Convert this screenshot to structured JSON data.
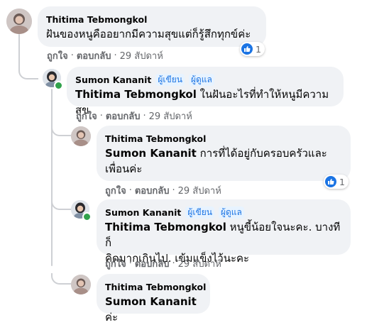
{
  "comments": [
    {
      "author": "Thitima Tebmongkol",
      "text": "ฝันของหนูคืออยากมีความสุขแต่ก็รู้สึกทุกข์ค่ะ",
      "like_label": "ถูกใจ",
      "reply_label": "ตอบกลับ",
      "time": "29 สัปดาห์",
      "reaction_count": "1"
    },
    {
      "author": "Sumon Kananit",
      "badges": [
        "ผู้เขียน",
        "ผู้ดูแล"
      ],
      "mention": "Thitima Tebmongkol",
      "text": " ในฝันอะไรที่ทำให้หนูมีความสุข",
      "like_label": "ถูกใจ",
      "reply_label": "ตอบกลับ",
      "time": "29 สัปดาห์"
    },
    {
      "author": "Thitima Tebmongkol",
      "mention": "Sumon Kananit",
      "text_line1": " การที่ได้อยู่กับครอบครัวและ",
      "text_line2": "เพื่อนค่ะ",
      "like_label": "ถูกใจ",
      "reply_label": "ตอบกลับ",
      "time": "29 สัปดาห์",
      "reaction_count": "1"
    },
    {
      "author": "Sumon Kananit",
      "badges": [
        "ผู้เขียน",
        "ผู้ดูแล"
      ],
      "mention": "Thitima Tebmongkol",
      "text_line1": " หนูขี้น้อยใจนะคะ. บางทีก็",
      "text_line2": "คิดมากเกินไป. เข้มแข็งไว้นะคะ",
      "like_label": "ถูกใจ",
      "reply_label": "ตอบกลับ",
      "time": "29 สัปดาห์"
    },
    {
      "author": "Thitima Tebmongkol",
      "mention": "Sumon Kananit",
      "text": " ค่ะ"
    }
  ],
  "separator": "·",
  "colors": {
    "bubble": "#f0f2f5",
    "badge_text": "#1b74e4",
    "badge_bg": "#e7f3ff",
    "meta": "#65676b",
    "like_blue": "#1b74e4",
    "online": "#31a24c"
  },
  "icons": {
    "reaction": "thumbs-up-icon",
    "avatar_1": "avatar-thitima",
    "avatar_2": "avatar-sumon"
  }
}
